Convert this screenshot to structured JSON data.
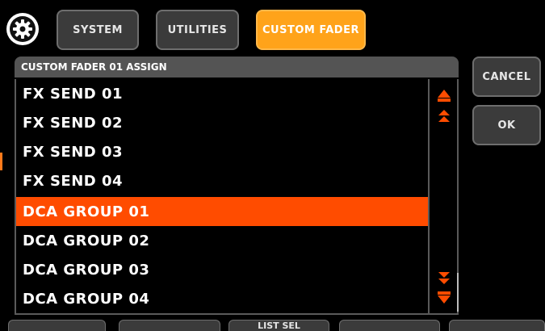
{
  "top_tabs": [
    {
      "label": "SYSTEM",
      "active": false
    },
    {
      "label": "UTILITIES",
      "active": false
    },
    {
      "label": "CUSTOM FADER",
      "active": true
    }
  ],
  "settings_icon": "gear-icon",
  "panel": {
    "title": "CUSTOM FADER 01 ASSIGN",
    "items": [
      {
        "label": "FX SEND 01",
        "selected": false
      },
      {
        "label": "FX SEND 02",
        "selected": false
      },
      {
        "label": "FX SEND 03",
        "selected": false
      },
      {
        "label": "FX SEND 04",
        "selected": false
      },
      {
        "label": "DCA GROUP 01",
        "selected": true
      },
      {
        "label": "DCA GROUP 02",
        "selected": false
      },
      {
        "label": "DCA GROUP 03",
        "selected": false
      },
      {
        "label": "DCA GROUP 04",
        "selected": false
      }
    ],
    "scroll_icons": [
      "scroll-up-icon",
      "page-up-icon",
      "page-down-icon",
      "scroll-down-icon"
    ]
  },
  "side_buttons": {
    "cancel": "CANCEL",
    "ok": "OK"
  },
  "softkeys": [
    "",
    "",
    "LIST SEL",
    "",
    ""
  ],
  "colors": {
    "accent_orange": "#ff4c00",
    "tab_active": "#ffa31a",
    "arrow": "#ff4c00"
  }
}
